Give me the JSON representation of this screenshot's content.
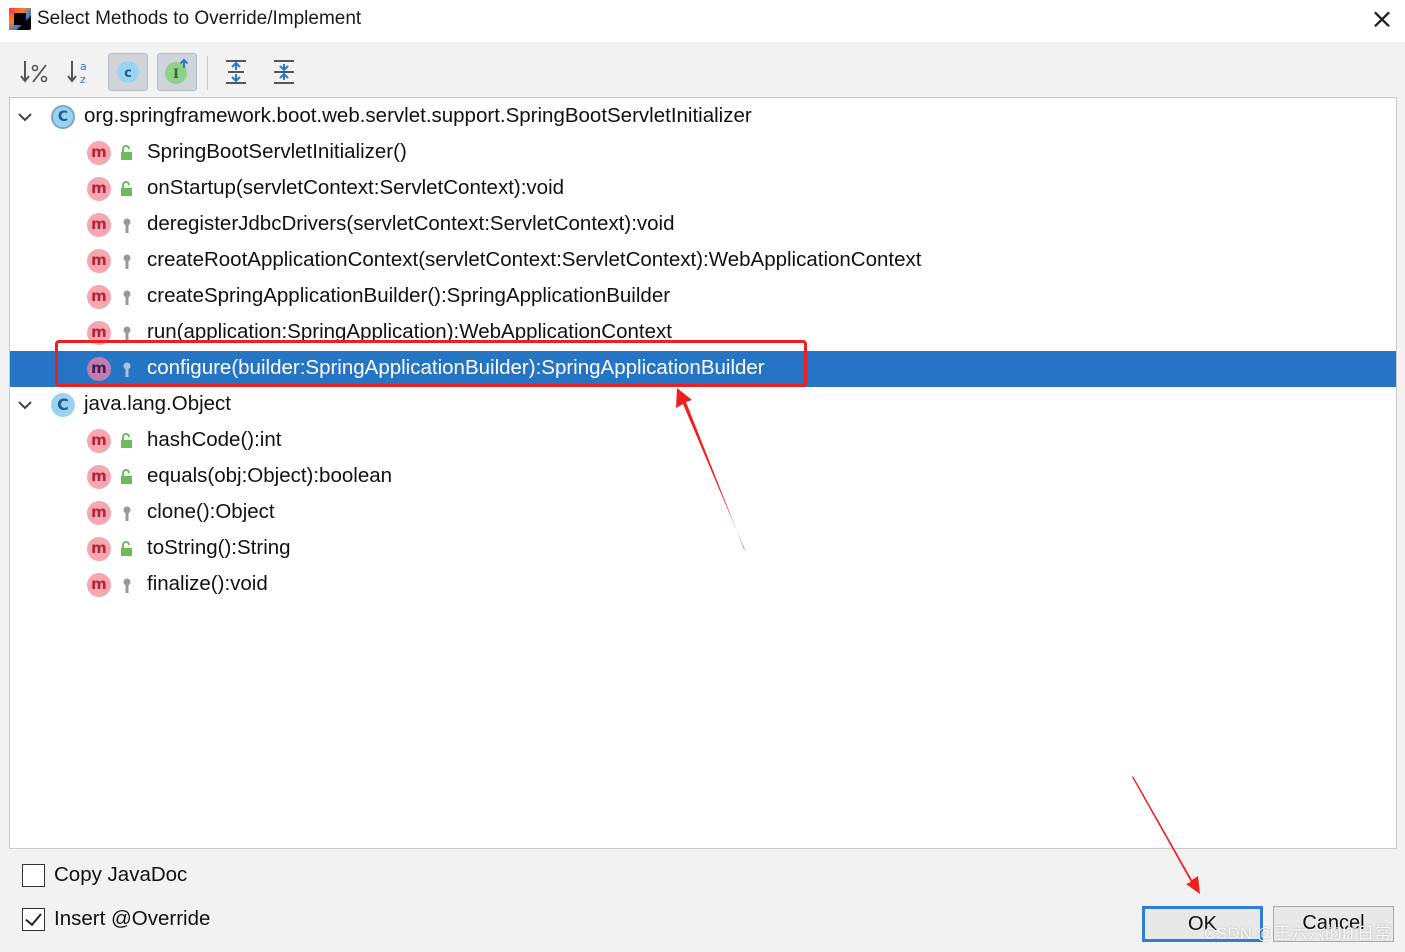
{
  "window": {
    "title": "Select Methods to Override/Implement",
    "close_glyph": "×"
  },
  "toolbar": {
    "buttons": [
      {
        "name": "sort-by-visibility",
        "icon": "sort-visibility-icon",
        "active": false
      },
      {
        "name": "sort-alphabetically",
        "icon": "sort-alpha-icon",
        "active": false
      },
      {
        "name": "show-classes",
        "icon": "class-c-icon",
        "active": true
      },
      {
        "name": "show-interfaces",
        "icon": "interface-i-icon",
        "active": true
      },
      {
        "name": "expand-all",
        "icon": "expand-all-icon",
        "active": false
      },
      {
        "name": "collapse-all",
        "icon": "collapse-all-icon",
        "active": false
      }
    ]
  },
  "tree": {
    "groups": [
      {
        "label": "org.springframework.boot.web.servlet.support.SpringBootServletInitializer",
        "icon": "abstract-class-icon",
        "methods": [
          {
            "label": "SpringBootServletInitializer()",
            "visibility": "public"
          },
          {
            "label": "onStartup(servletContext:ServletContext):void",
            "visibility": "public"
          },
          {
            "label": "deregisterJdbcDrivers(servletContext:ServletContext):void",
            "visibility": "protected"
          },
          {
            "label": "createRootApplicationContext(servletContext:ServletContext):WebApplicationContext",
            "visibility": "protected"
          },
          {
            "label": "createSpringApplicationBuilder():SpringApplicationBuilder",
            "visibility": "protected"
          },
          {
            "label": "run(application:SpringApplication):WebApplicationContext",
            "visibility": "protected"
          },
          {
            "label": "configure(builder:SpringApplicationBuilder):SpringApplicationBuilder",
            "visibility": "protected",
            "selected": true
          }
        ]
      },
      {
        "label": "java.lang.Object",
        "icon": "class-icon",
        "methods": [
          {
            "label": "hashCode():int",
            "visibility": "public"
          },
          {
            "label": "equals(obj:Object):boolean",
            "visibility": "public"
          },
          {
            "label": "clone():Object",
            "visibility": "protected"
          },
          {
            "label": "toString():String",
            "visibility": "public"
          },
          {
            "label": "finalize():void",
            "visibility": "protected"
          }
        ]
      }
    ],
    "method_icon_letter": "m",
    "class_icon_letter": "C"
  },
  "options": {
    "copy_javadoc": {
      "label": "Copy JavaDoc",
      "checked": false
    },
    "insert_override": {
      "label": "Insert @Override",
      "checked": true
    }
  },
  "buttons": {
    "ok": "OK",
    "cancel": "Cancel"
  },
  "watermark": "CSDN @王六六的IT日常",
  "colors": {
    "selection": "#2675c4",
    "annotation_red": "#f01e1e",
    "ok_border": "#2f7fd8"
  }
}
